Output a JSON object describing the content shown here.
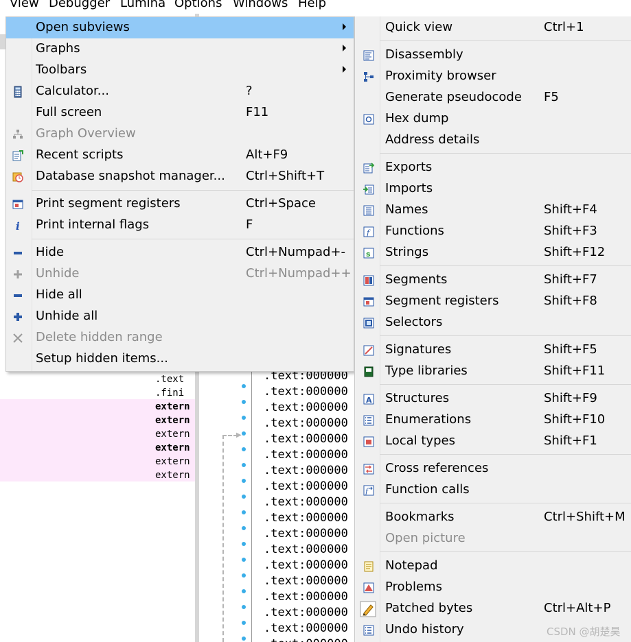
{
  "menubar": [
    "View",
    "Debugger",
    "Lumina",
    "Options",
    "Windows",
    "Help"
  ],
  "background": {
    "segments": [
      ".text",
      ".fini",
      "extern",
      "extern",
      "extern",
      "extern",
      "extern",
      "extern"
    ],
    "code_line": ".text:000000"
  },
  "view_menu": {
    "items": [
      {
        "label": "Open subviews",
        "shortcut": "",
        "icon": "none",
        "submenu": true,
        "highlighted": true
      },
      {
        "label": "Graphs",
        "shortcut": "",
        "icon": "none",
        "submenu": true
      },
      {
        "label": "Toolbars",
        "shortcut": "",
        "icon": "none",
        "submenu": true
      },
      {
        "label": "Calculator...",
        "shortcut": "?",
        "icon": "calculator-icon"
      },
      {
        "label": "Full screen",
        "shortcut": "F11",
        "icon": "none"
      },
      {
        "label": "Graph Overview",
        "shortcut": "",
        "icon": "graph-overview-icon",
        "disabled": true
      },
      {
        "label": "Recent scripts",
        "shortcut": "Alt+F9",
        "icon": "recent-scripts-icon"
      },
      {
        "label": "Database snapshot manager...",
        "shortcut": "Ctrl+Shift+T",
        "icon": "snapshot-icon"
      },
      {
        "label": "Print segment registers",
        "shortcut": "Ctrl+Space",
        "icon": "segment-registers-icon"
      },
      {
        "label": "Print internal flags",
        "shortcut": "F",
        "icon": "info-icon"
      },
      {
        "label": "Hide",
        "shortcut": "Ctrl+Numpad+-",
        "icon": "minus-icon"
      },
      {
        "label": "Unhide",
        "shortcut": "Ctrl+Numpad++",
        "icon": "plus-icon",
        "disabled": true
      },
      {
        "label": "Hide all",
        "shortcut": "",
        "icon": "minus-icon"
      },
      {
        "label": "Unhide all",
        "shortcut": "",
        "icon": "plus-icon"
      },
      {
        "label": "Delete hidden range",
        "shortcut": "",
        "icon": "close-icon",
        "disabled": true
      },
      {
        "label": "Setup hidden items...",
        "shortcut": "",
        "icon": "none"
      }
    ]
  },
  "subviews_menu": {
    "items": [
      {
        "label": "Quick view",
        "shortcut": "Ctrl+1",
        "icon": "none"
      },
      {
        "label": "Disassembly",
        "shortcut": "",
        "icon": "disassembly-icon"
      },
      {
        "label": "Proximity browser",
        "shortcut": "",
        "icon": "proximity-icon"
      },
      {
        "label": "Generate pseudocode",
        "shortcut": "F5",
        "icon": "none"
      },
      {
        "label": "Hex dump",
        "shortcut": "",
        "icon": "hex-dump-icon"
      },
      {
        "label": "Address details",
        "shortcut": "",
        "icon": "none"
      },
      {
        "label": "Exports",
        "shortcut": "",
        "icon": "exports-icon"
      },
      {
        "label": "Imports",
        "shortcut": "",
        "icon": "imports-icon"
      },
      {
        "label": "Names",
        "shortcut": "Shift+F4",
        "icon": "names-icon"
      },
      {
        "label": "Functions",
        "shortcut": "Shift+F3",
        "icon": "functions-icon"
      },
      {
        "label": "Strings",
        "shortcut": "Shift+F12",
        "icon": "strings-icon"
      },
      {
        "label": "Segments",
        "shortcut": "Shift+F7",
        "icon": "segments-icon"
      },
      {
        "label": "Segment registers",
        "shortcut": "Shift+F8",
        "icon": "segment-registers-icon"
      },
      {
        "label": "Selectors",
        "shortcut": "",
        "icon": "selectors-icon"
      },
      {
        "label": "Signatures",
        "shortcut": "Shift+F5",
        "icon": "signatures-icon"
      },
      {
        "label": "Type libraries",
        "shortcut": "Shift+F11",
        "icon": "type-libraries-icon"
      },
      {
        "label": "Structures",
        "shortcut": "Shift+F9",
        "icon": "structures-icon"
      },
      {
        "label": "Enumerations",
        "shortcut": "Shift+F10",
        "icon": "enumerations-icon"
      },
      {
        "label": "Local types",
        "shortcut": "Shift+F1",
        "icon": "local-types-icon"
      },
      {
        "label": "Cross references",
        "shortcut": "",
        "icon": "cross-references-icon"
      },
      {
        "label": "Function calls",
        "shortcut": "",
        "icon": "function-calls-icon"
      },
      {
        "label": "Bookmarks",
        "shortcut": "Ctrl+Shift+M",
        "icon": "none"
      },
      {
        "label": "Open picture",
        "shortcut": "",
        "icon": "none",
        "disabled": true
      },
      {
        "label": "Notepad",
        "shortcut": "",
        "icon": "notepad-icon"
      },
      {
        "label": "Problems",
        "shortcut": "",
        "icon": "problems-icon"
      },
      {
        "label": "Patched bytes",
        "shortcut": "Ctrl+Alt+P",
        "icon": "patched-bytes-icon"
      },
      {
        "label": "Undo history",
        "shortcut": "",
        "icon": "undo-history-icon"
      }
    ]
  },
  "watermark": "CSDN @胡楚昊",
  "colors": {
    "highlight": "#91c9f7",
    "menu_bg": "#f0f0f0",
    "disabled_text": "#8c8c8c",
    "pink_row": "#fde8fb"
  }
}
